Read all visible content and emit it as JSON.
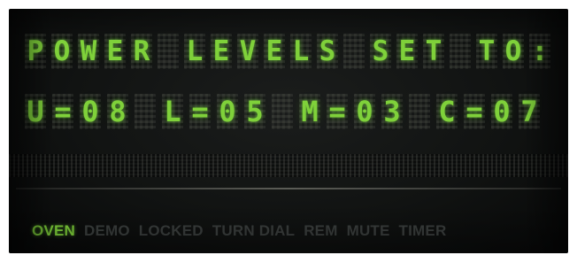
{
  "display": {
    "line1": "POWER LEVELS SET TO:",
    "line2": "U=08 L=05 M=03 C=07",
    "lit_color": "#7fd13a",
    "unlit_color": "#3b3f3e"
  },
  "indicators": [
    {
      "label": "OVEN",
      "active": true
    },
    {
      "label": "DEMO",
      "active": false
    },
    {
      "label": "LOCKED",
      "active": false
    },
    {
      "label": "TURN DIAL",
      "active": false
    },
    {
      "label": "REM",
      "active": false
    },
    {
      "label": "MUTE",
      "active": false
    },
    {
      "label": "TIMER",
      "active": false
    }
  ]
}
